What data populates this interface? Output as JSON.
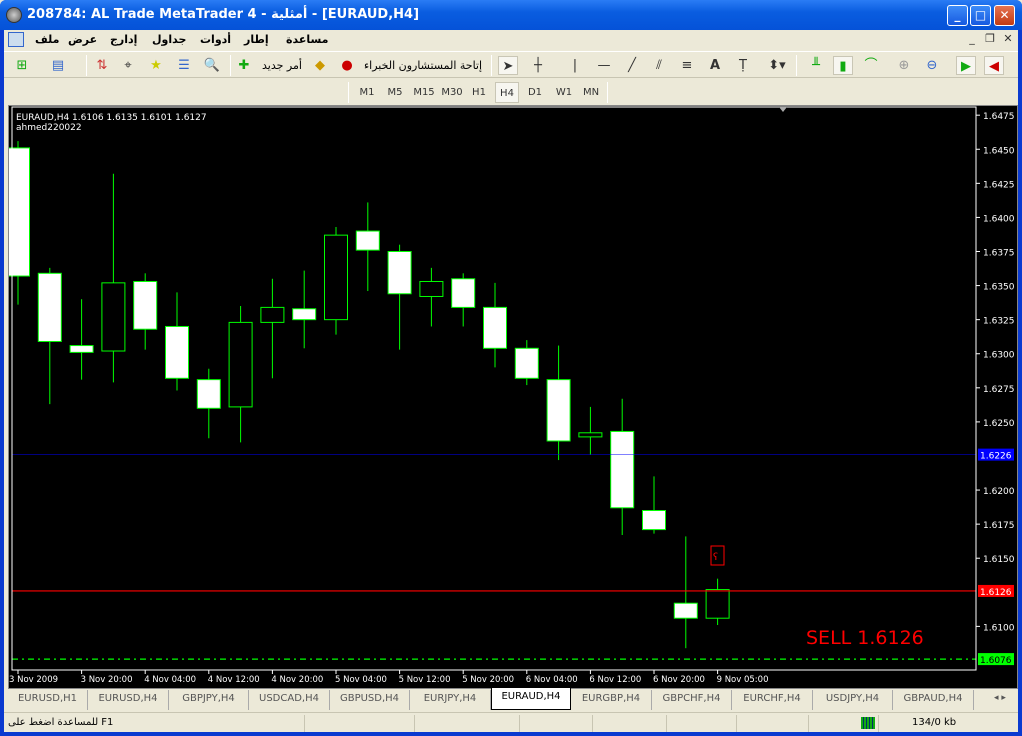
{
  "window": {
    "title": "208784: AL Trade MetaTrader 4 - أمثلية - [EURAUD,H4]"
  },
  "menu": [
    "ملف",
    "عرض",
    "إدارج",
    "جداول",
    "أدوات",
    "إطار",
    "مساعدة"
  ],
  "toolbar": {
    "new_order": "أمر جديد",
    "expert_advisors": "إتاحة المستشارون الخبراء"
  },
  "timeframes": [
    "M1",
    "M5",
    "M15",
    "M30",
    "H1",
    "H4",
    "D1",
    "W1",
    "MN"
  ],
  "active_timeframe": "H4",
  "chart_data": {
    "type": "candlestick",
    "symbol_info": "EURAUD,H4  1.6106 1.6135 1.6101 1.6127",
    "account_label": "ahmed220022",
    "ylim": [
      1.6068,
      1.6481
    ],
    "y_ticks": [
      "1.6475",
      "1.6450",
      "1.6425",
      "1.6400",
      "1.6375",
      "1.6350",
      "1.6325",
      "1.6300",
      "1.6275",
      "1.6250",
      "1.6200",
      "1.6175",
      "1.6150",
      "1.6100"
    ],
    "x_labels": [
      "3 Nov 2009",
      "3 Nov 20:00",
      "4 Nov 04:00",
      "4 Nov 12:00",
      "4 Nov 20:00",
      "5 Nov 04:00",
      "5 Nov 12:00",
      "5 Nov 20:00",
      "6 Nov 04:00",
      "6 Nov 12:00",
      "6 Nov 20:00",
      "9 Nov 05:00"
    ],
    "candles": [
      {
        "o": 1.6451,
        "h": 1.6456,
        "l": 1.6336,
        "c": 1.6357
      },
      {
        "o": 1.6359,
        "h": 1.6363,
        "l": 1.6263,
        "c": 1.6309
      },
      {
        "o": 1.6306,
        "h": 1.634,
        "l": 1.6281,
        "c": 1.6301
      },
      {
        "o": 1.6302,
        "h": 1.6432,
        "l": 1.6279,
        "c": 1.6352
      },
      {
        "o": 1.6353,
        "h": 1.6359,
        "l": 1.6303,
        "c": 1.6318
      },
      {
        "o": 1.632,
        "h": 1.6345,
        "l": 1.6273,
        "c": 1.6282
      },
      {
        "o": 1.6281,
        "h": 1.6289,
        "l": 1.6238,
        "c": 1.626
      },
      {
        "o": 1.6261,
        "h": 1.6335,
        "l": 1.6235,
        "c": 1.6323
      },
      {
        "o": 1.6323,
        "h": 1.6355,
        "l": 1.6282,
        "c": 1.6334
      },
      {
        "o": 1.6333,
        "h": 1.6361,
        "l": 1.6304,
        "c": 1.6325
      },
      {
        "o": 1.6325,
        "h": 1.6393,
        "l": 1.6314,
        "c": 1.6387
      },
      {
        "o": 1.639,
        "h": 1.6411,
        "l": 1.6346,
        "c": 1.6376
      },
      {
        "o": 1.6375,
        "h": 1.638,
        "l": 1.6303,
        "c": 1.6344
      },
      {
        "o": 1.6342,
        "h": 1.6363,
        "l": 1.632,
        "c": 1.6353
      },
      {
        "o": 1.6355,
        "h": 1.6359,
        "l": 1.632,
        "c": 1.6334
      },
      {
        "o": 1.6334,
        "h": 1.6352,
        "l": 1.629,
        "c": 1.6304
      },
      {
        "o": 1.6304,
        "h": 1.631,
        "l": 1.6277,
        "c": 1.6282
      },
      {
        "o": 1.6281,
        "h": 1.6306,
        "l": 1.6222,
        "c": 1.6236
      },
      {
        "o": 1.6239,
        "h": 1.6261,
        "l": 1.6226,
        "c": 1.6242
      },
      {
        "o": 1.6243,
        "h": 1.6267,
        "l": 1.6167,
        "c": 1.6187
      },
      {
        "o": 1.6185,
        "h": 1.621,
        "l": 1.6168,
        "c": 1.6171
      },
      {
        "o": 1.6117,
        "h": 1.6166,
        "l": 1.6084,
        "c": 1.6106
      },
      {
        "o": 1.6106,
        "h": 1.6135,
        "l": 1.6101,
        "c": 1.6127
      }
    ],
    "lines": [
      {
        "name": "level-line",
        "price": 1.6226,
        "label": "1.6226",
        "color": "#0000ff"
      },
      {
        "name": "bid-line",
        "price": 1.6126,
        "label": "1.6126",
        "color": "#ff0000"
      },
      {
        "name": "stop-line",
        "price": 1.6076,
        "label": "1.6076",
        "color": "#00ff00"
      }
    ],
    "annotation": "SELL 1.6126",
    "colors": {
      "bull_body": "#000000",
      "bear_body": "#ffffff",
      "outline": "#00ff00",
      "text": "#ffffff",
      "sell": "#ff0000"
    }
  },
  "tabs": [
    "EURUSD,H1",
    "EURUSD,H4",
    "GBPJPY,H4",
    "USDCAD,H4",
    "GBPUSD,H4",
    "EURJPY,H4",
    "EURAUD,H4",
    "EURGBP,H4",
    "GBPCHF,H4",
    "EURCHF,H4",
    "USDJPY,H4",
    "GBPAUD,H4"
  ],
  "active_tab": "EURAUD,H4",
  "status": {
    "help": "للمساعدة اضغط على F1",
    "traffic": "134/0 kb"
  }
}
